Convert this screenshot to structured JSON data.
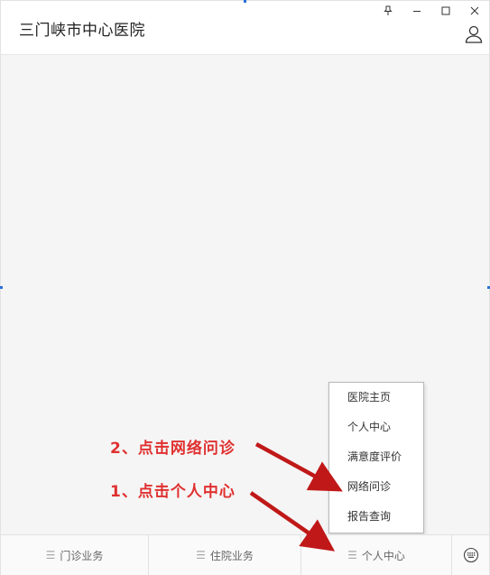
{
  "window": {
    "title": "三门峡市中心医院",
    "controls": [
      "pin-icon",
      "minimize-icon",
      "maximize-icon",
      "close-icon"
    ]
  },
  "popup_menu": {
    "items": [
      "医院主页",
      "个人中心",
      "满意度评价",
      "网络问诊",
      "报告查询"
    ]
  },
  "bottom_nav": {
    "tabs": [
      "门诊业务",
      "住院业务",
      "个人中心"
    ],
    "keyboard_icon": "keyboard-icon"
  },
  "annotations": {
    "step1": "1、点击个人中心",
    "step2": "2、点击网络问诊",
    "color": "#e03030"
  },
  "colors": {
    "arrow": "#c01818",
    "accent": "#2a6fdb"
  }
}
